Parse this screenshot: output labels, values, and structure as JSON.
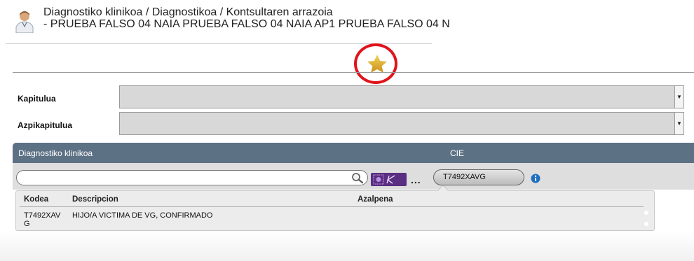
{
  "header": {
    "breadcrumb": "Diagnostiko klinikoa / Diagnostikoa / Kontsultaren arrazoia",
    "patient_line": " - PRUEBA FALSO 04 NAIA PRUEBA FALSO 04 NAIA AP1 PRUEBA FALSO 04 N"
  },
  "form": {
    "kapitulua_label": "Kapitulua",
    "azpikapitulua_label": "Azpikapitulua",
    "kapitulua_value": "",
    "azpikapitulua_value": ""
  },
  "section": {
    "title": "Diagnostiko klinikoa",
    "cie_label": "CIE"
  },
  "search": {
    "value": "",
    "ellipsis": "...",
    "cie_code": "T7492XAVG"
  },
  "results": {
    "columns": [
      "Kodea",
      "Descripcion",
      "Azalpena"
    ],
    "rows": [
      {
        "code": "T7492XAVG",
        "code_line1": "T7492XAV",
        "code_line2": "G",
        "description": "HIJO/A VICTIMA DE VG, CONFIRMADO",
        "azalpena": ""
      }
    ]
  },
  "icons": {
    "avatar": "doctor-avatar-icon",
    "favorite": "star-icon",
    "search": "magnifier-icon",
    "purple_button": "diagnosis-tool-icon",
    "info": "info-icon"
  },
  "colors": {
    "section_bar": "#5d7185",
    "highlight_ring": "#e0141c",
    "star": "#e3b424",
    "purple_button": "#5a2e82",
    "info": "#1f6fc0"
  }
}
